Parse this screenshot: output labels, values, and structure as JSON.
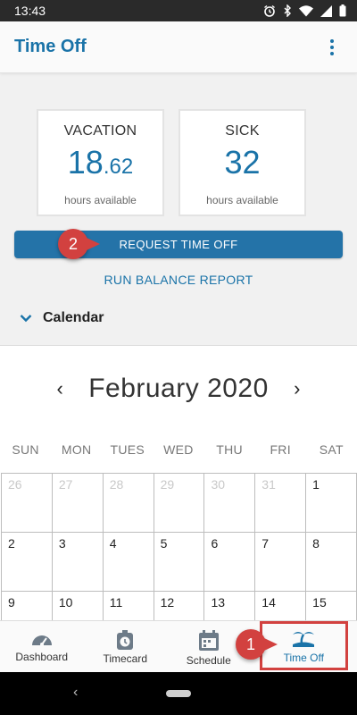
{
  "status_bar": {
    "time": "13:43"
  },
  "app_bar": {
    "title": "Time Off"
  },
  "balances": [
    {
      "label": "VACATION",
      "value_int": "18",
      "value_dec": ".62",
      "sub": "hours available"
    },
    {
      "label": "SICK",
      "value_int": "32",
      "value_dec": "",
      "sub": "hours available"
    }
  ],
  "actions": {
    "request_label": "REQUEST TIME OFF",
    "report_label": "RUN BALANCE REPORT"
  },
  "callouts": {
    "first": "1",
    "second": "2"
  },
  "calendar": {
    "section_title": "Calendar",
    "month": "February 2020",
    "weekdays": [
      "SUN",
      "MON",
      "TUES",
      "WED",
      "THU",
      "FRI",
      "SAT"
    ],
    "weeks": [
      [
        {
          "d": "26",
          "other": true
        },
        {
          "d": "27",
          "other": true
        },
        {
          "d": "28",
          "other": true
        },
        {
          "d": "29",
          "other": true
        },
        {
          "d": "30",
          "other": true
        },
        {
          "d": "31",
          "other": true
        },
        {
          "d": "1",
          "other": false
        }
      ],
      [
        {
          "d": "2",
          "other": false
        },
        {
          "d": "3",
          "other": false
        },
        {
          "d": "4",
          "other": false
        },
        {
          "d": "5",
          "other": false
        },
        {
          "d": "6",
          "other": false
        },
        {
          "d": "7",
          "other": false
        },
        {
          "d": "8",
          "other": false
        }
      ],
      [
        {
          "d": "9",
          "other": false
        },
        {
          "d": "10",
          "other": false
        },
        {
          "d": "11",
          "other": false
        },
        {
          "d": "12",
          "other": false
        },
        {
          "d": "13",
          "other": false
        },
        {
          "d": "14",
          "other": false
        },
        {
          "d": "15",
          "other": false
        }
      ]
    ]
  },
  "bottom_nav": [
    {
      "label": "Dashboard",
      "icon": "speedometer-icon",
      "active": false
    },
    {
      "label": "Timecard",
      "icon": "stopwatch-icon",
      "active": false
    },
    {
      "label": "Schedule",
      "icon": "calendar-icon",
      "active": false
    },
    {
      "label": "Time Off",
      "icon": "island-icon",
      "active": true
    }
  ],
  "colors": {
    "brand": "#1a73a8",
    "button": "#2473a8",
    "callout": "#d2413f"
  }
}
